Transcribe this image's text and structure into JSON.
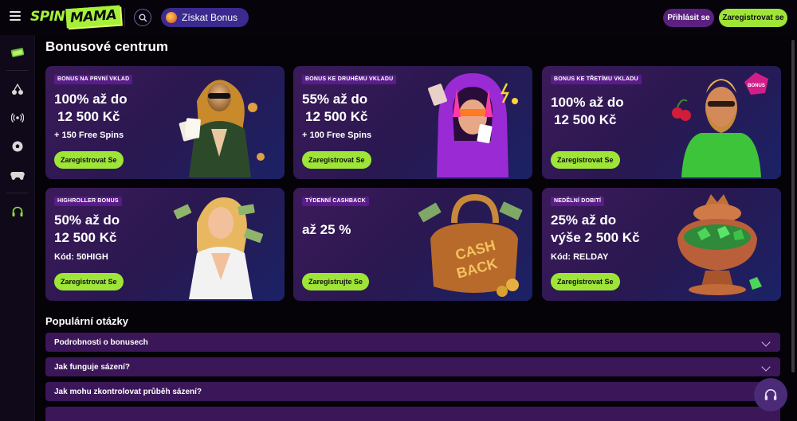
{
  "header": {
    "logo_left": "SPIN",
    "logo_right": "MAMA",
    "bonus_button": "Získat Bonus",
    "login_button": "Přihlásit se",
    "register_button": "Zaregistrovat se"
  },
  "page_title": "Bonusové centrum",
  "cards": [
    {
      "badge": "BONUS NA PRVNÍ VKLAD",
      "line1": "100% až do",
      "line2": "12 500 Kč",
      "sub": "+ 150 Free Spins",
      "cta": "Zaregistrovat Se"
    },
    {
      "badge": "BONUS KE DRUHÉMU VKLADU",
      "line1": "55% až do",
      "line2": "12 500 Kč",
      "sub": "+ 100 Free Spins",
      "cta": "Zaregistrovat Se"
    },
    {
      "badge": "BONUS KE TŘETÍMU VKLADU",
      "line1": "100% až do",
      "line2": "12 500 Kč",
      "sub": "",
      "cta": "Zaregistrovat Se"
    },
    {
      "badge": "HIGHROLLER BONUS",
      "line1": "50% až do",
      "line2": "12 500 Kč",
      "sub": "Kód: 50HIGH",
      "cta": "Zaregistrovat Se"
    },
    {
      "badge": "TÝDENNÍ CASHBACK",
      "line1": "až 25 %",
      "line2": "",
      "sub": "",
      "cta": "Zaregistrujte Se"
    },
    {
      "badge": "NEDĚLNÍ DOBITÍ",
      "line1": "25% až do",
      "line2": "výše 2 500 Kč",
      "sub": "Kód: RELDAY",
      "cta": "Zaregistrovat Se"
    }
  ],
  "art_text": {
    "cashback_top": "CASH",
    "cashback_bottom": "BACK",
    "bonus_gem": "BONUS"
  },
  "faq": {
    "title": "Populární otázky",
    "items": [
      "Podrobnosti o bonusech",
      "Jak funguje sázení?",
      "Jak mohu zkontrolovat průběh sázení?"
    ]
  },
  "colors": {
    "accent": "#9ee538",
    "purple": "#3b1659",
    "badge": "#5a1c8a"
  },
  "icons": {
    "sidebar": [
      "promo-icon",
      "cherry-icon",
      "live-icon",
      "football-icon",
      "gamepad-icon",
      "headset-icon"
    ]
  }
}
